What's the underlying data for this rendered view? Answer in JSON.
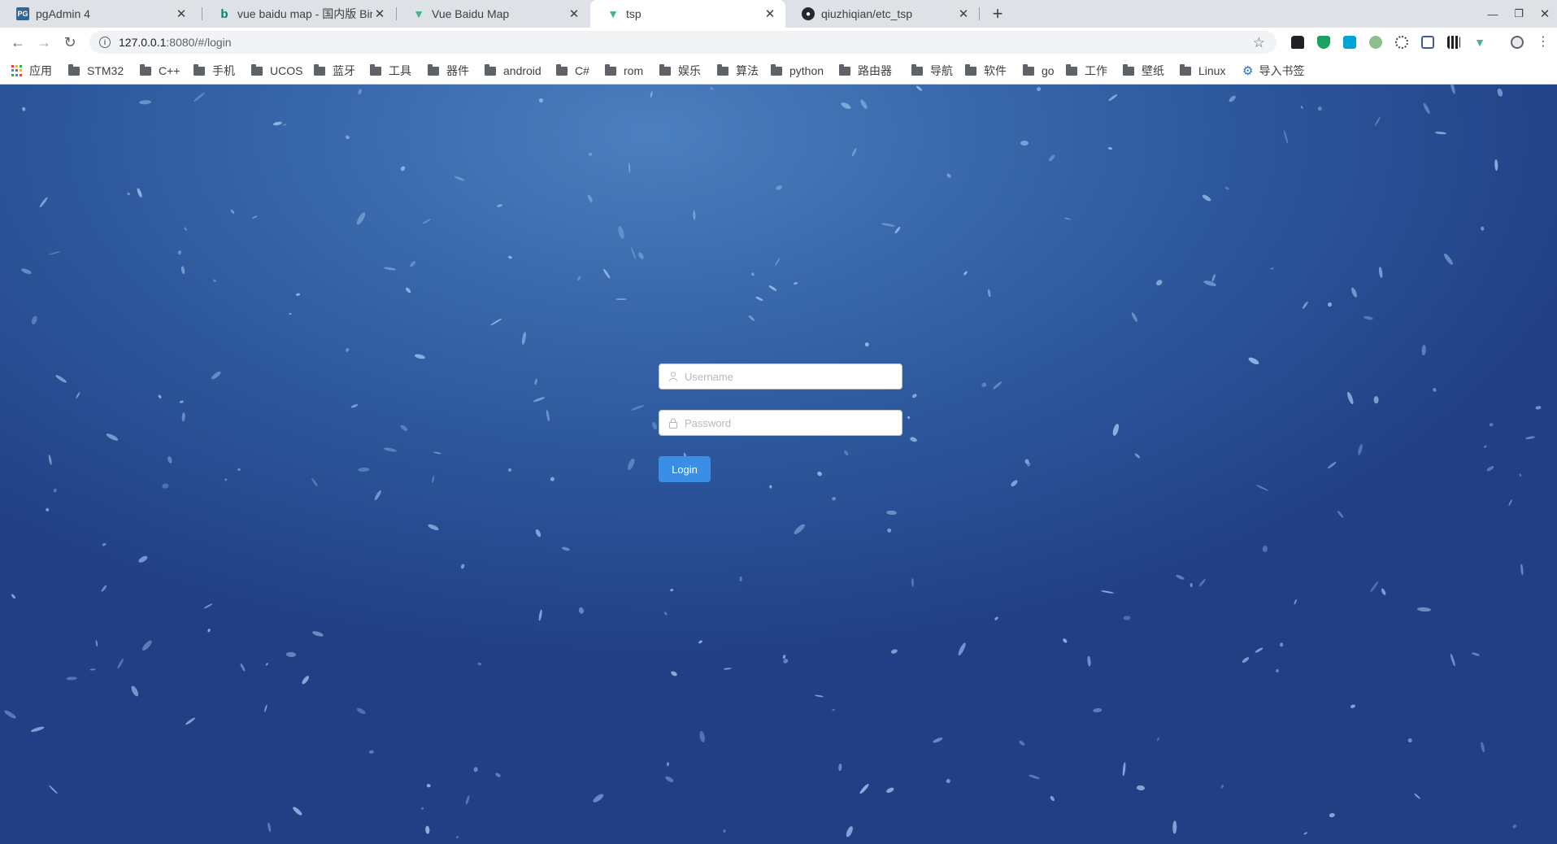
{
  "tabs": [
    {
      "title": "pgAdmin 4",
      "favicon": "pgadmin-icon",
      "active": false
    },
    {
      "title": "vue baidu map - 国内版 Bing",
      "favicon": "bing-icon",
      "active": false
    },
    {
      "title": "Vue Baidu Map",
      "favicon": "vue-icon",
      "active": false
    },
    {
      "title": "tsp",
      "favicon": "vue-icon",
      "active": true
    },
    {
      "title": "qiuzhiqian/etc_tsp",
      "favicon": "github-icon",
      "active": false
    }
  ],
  "address": {
    "host": "127.0.0.1",
    "path": ":8080/#/login"
  },
  "bookmarks": {
    "apps": "应用",
    "folders": [
      "STM32",
      "C++",
      "手机",
      "UCOS",
      "蓝牙",
      "工具",
      "器件",
      "android",
      "C#",
      "rom",
      "娱乐",
      "算法",
      "python",
      "路由器",
      "导航",
      "软件",
      "go",
      "工作",
      "壁纸",
      "Linux"
    ],
    "import": "导入书签"
  },
  "login": {
    "username_placeholder": "Username",
    "password_placeholder": "Password",
    "button": "Login"
  },
  "colors": {
    "accent": "#3a8ee6",
    "background_top": "#4c7fbf",
    "background_bottom": "#223f85"
  }
}
